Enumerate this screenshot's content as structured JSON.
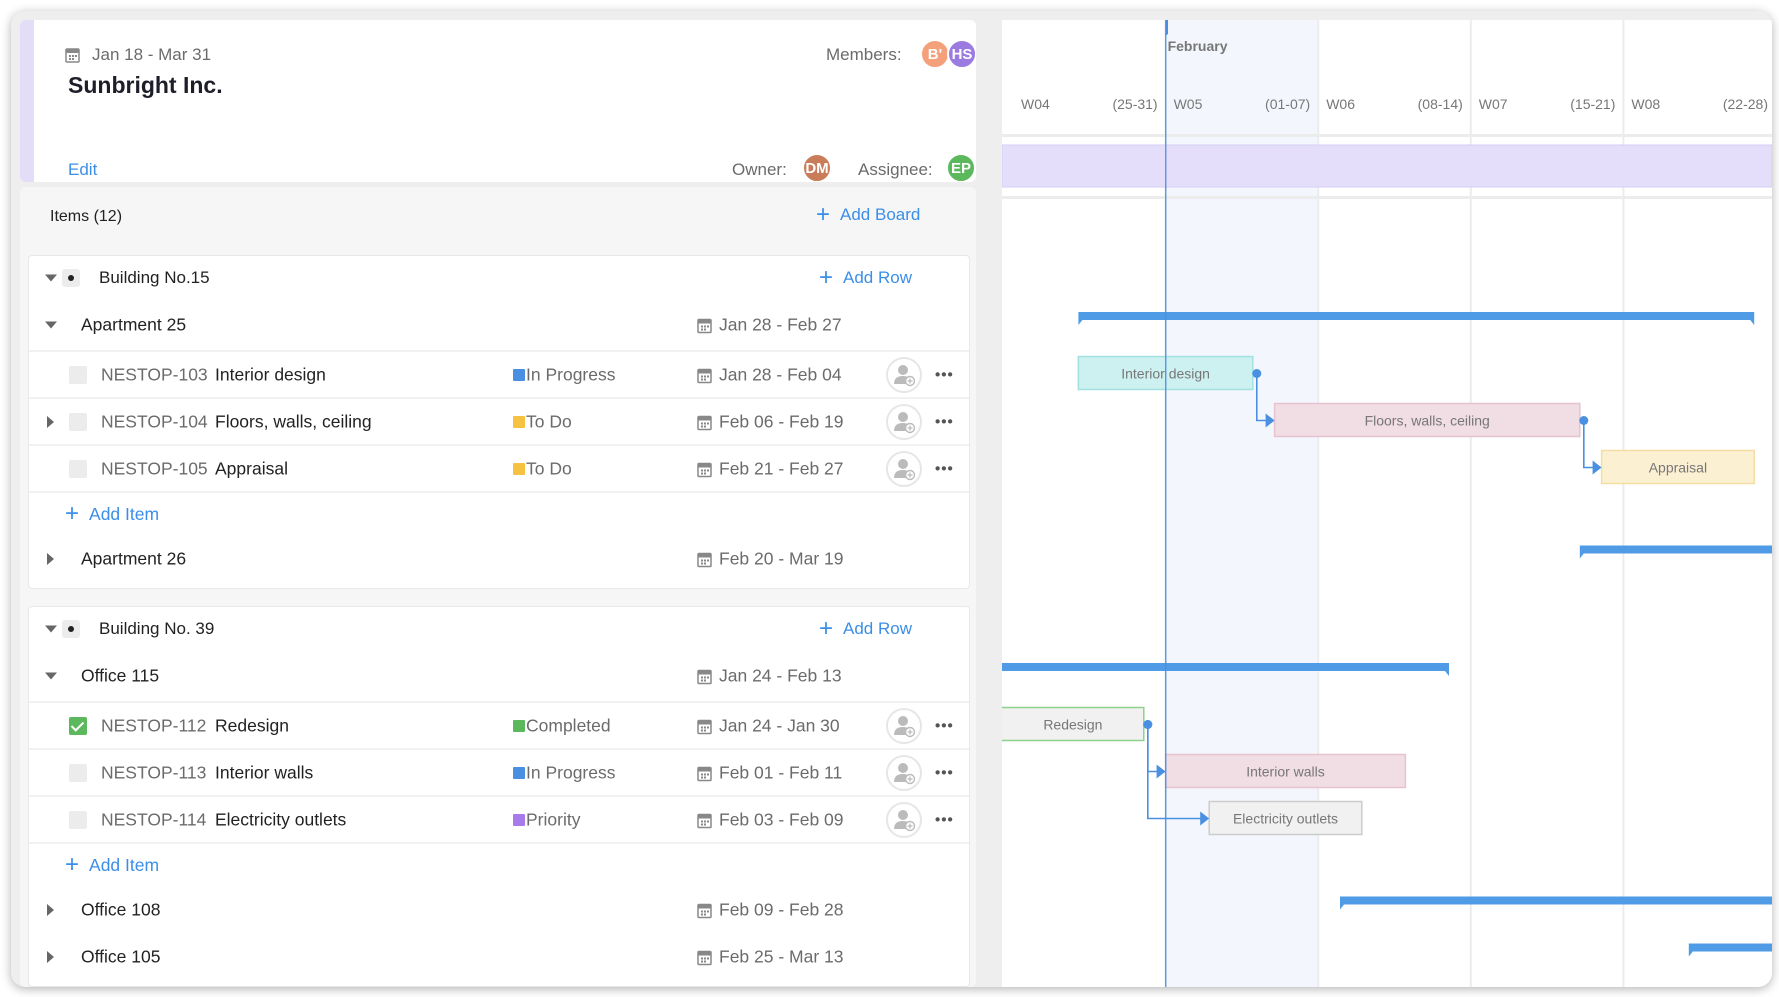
{
  "header": {
    "date_range": "Jan 18 - Mar 31",
    "title": "Sunbright Inc.",
    "members_label": "Members:",
    "members": [
      {
        "initials": "B'",
        "color": "#f4a07a"
      },
      {
        "initials": "HS",
        "color": "#9b7be0"
      }
    ],
    "edit_label": "Edit",
    "owner_label": "Owner:",
    "owner": {
      "initials": "DM",
      "color": "#c97c5a"
    },
    "assignee_label": "Assignee:",
    "assignee": {
      "initials": "EP",
      "color": "#5cb85c"
    }
  },
  "items": {
    "title": "Items (12)",
    "add_board_label": "Add Board"
  },
  "boards": [
    {
      "name": "Building No.15",
      "add_row_label": "Add Row",
      "groups": [
        {
          "name": "Apartment 25",
          "dates": "Jan 28 - Feb 27",
          "expanded": true,
          "add_item_label": "Add Item",
          "tasks": [
            {
              "id": "NESTOP-103",
              "title": "Interior design",
              "status": "In Progress",
              "status_color": "#4a90e2",
              "dates": "Jan 28 - Feb 04",
              "checked": false,
              "has_children": false,
              "bar_color": "#cdf0f0",
              "bar_border": "#a3e1e1"
            },
            {
              "id": "NESTOP-104",
              "title": "Floors, walls, ceiling",
              "status": "To Do",
              "status_color": "#f5c242",
              "dates": "Feb 06 - Feb 19",
              "checked": false,
              "has_children": true,
              "bar_color": "#f1dde4",
              "bar_border": "#e6c3cf"
            },
            {
              "id": "NESTOP-105",
              "title": "Appraisal",
              "status": "To Do",
              "status_color": "#f5c242",
              "dates": "Feb 21 - Feb 27",
              "checked": false,
              "has_children": false,
              "bar_color": "#fcf0d2",
              "bar_border": "#f3dea2"
            }
          ]
        },
        {
          "name": "Apartment 26",
          "dates": "Feb 20 - Mar 19",
          "expanded": false
        }
      ]
    },
    {
      "name": "Building No. 39",
      "add_row_label": "Add Row",
      "groups": [
        {
          "name": "Office 115",
          "dates": "Jan 24 - Feb 13",
          "expanded": true,
          "add_item_label": "Add Item",
          "tasks": [
            {
              "id": "NESTOP-112",
              "title": "Redesign",
              "status": "Completed",
              "status_color": "#5cb85c",
              "dates": "Jan 24 - Jan 30",
              "checked": true,
              "has_children": false,
              "bar_color": "#f1f1f1",
              "bar_border": "#8fd18f"
            },
            {
              "id": "NESTOP-113",
              "title": "Interior walls",
              "status": "In Progress",
              "status_color": "#4a90e2",
              "dates": "Feb 01 - Feb 11",
              "checked": false,
              "has_children": false,
              "bar_color": "#f1dde4",
              "bar_border": "#e6c3cf"
            },
            {
              "id": "NESTOP-114",
              "title": "Electricity outlets",
              "status": "Priority",
              "status_color": "#a77bea",
              "dates": "Feb 03 - Feb 09",
              "checked": false,
              "has_children": false,
              "bar_color": "#f1f1f1",
              "bar_border": "#cccccc"
            }
          ]
        },
        {
          "name": "Office 108",
          "dates": "Feb 09 - Feb 28",
          "expanded": false
        },
        {
          "name": "Office 105",
          "dates": "Feb 25 - Mar 13",
          "expanded": false
        }
      ]
    }
  ],
  "gantt": {
    "month_label": "February",
    "weeks": [
      {
        "label": "W04",
        "range": "(25-31)"
      },
      {
        "label": "W05",
        "range": "(01-07)"
      },
      {
        "label": "W06",
        "range": "(08-14)"
      },
      {
        "label": "W07",
        "range": "(15-21)"
      },
      {
        "label": "W08",
        "range": "(22-28)"
      }
    ],
    "today": "Feb 01",
    "highlight_week": "W05",
    "project_band_color": "#e4defa",
    "summary_bar_color": "#4f9be6",
    "dependencies": [
      {
        "from": "NESTOP-103",
        "to": "NESTOP-104"
      },
      {
        "from": "NESTOP-104",
        "to": "NESTOP-105"
      },
      {
        "from": "NESTOP-112",
        "to": "NESTOP-113"
      },
      {
        "from": "NESTOP-112",
        "to": "NESTOP-114"
      }
    ]
  }
}
